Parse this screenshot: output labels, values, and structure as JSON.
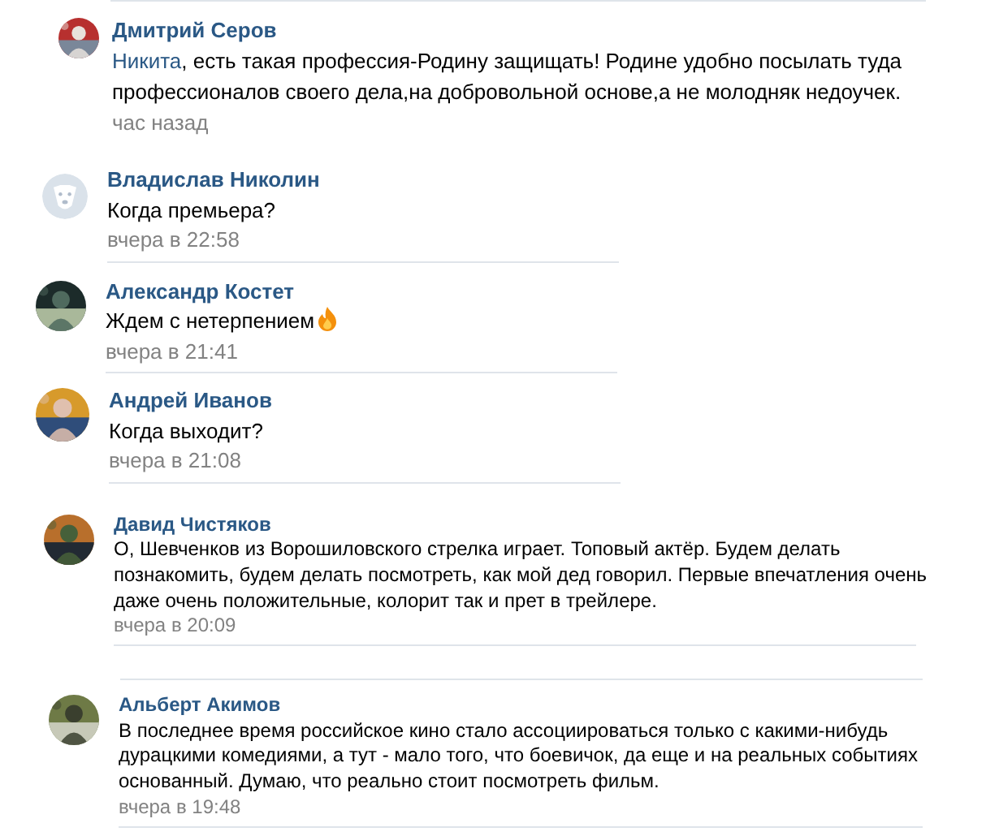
{
  "comments": [
    {
      "author": "Дмитрий Серов",
      "mention": "Никита",
      "text": ", есть такая профессия-Родину защищать! Родине удобно посылать туда профессионалов своего дела,на добровольной основе,а не молодняк недоучек.",
      "time": "час назад",
      "default_avatar": false,
      "emoji": false
    },
    {
      "author": "Владислав Николин",
      "text": "Когда премьера?",
      "time": "вчера в 22:58",
      "default_avatar": true,
      "emoji": false
    },
    {
      "author": "Александр Костет",
      "text": "Ждем с нетерпением",
      "time": "вчера в 21:41",
      "default_avatar": false,
      "emoji": true
    },
    {
      "author": "Андрей Иванов",
      "text": "Когда выходит?",
      "time": "вчера в 21:08",
      "default_avatar": false,
      "emoji": false
    },
    {
      "author": "Давид Чистяков",
      "text": "О, Шевченков из Ворошиловского стрелка играет. Топовый актёр. Будем делать познакомить, будем делать посмотреть, как мой дед говорил. Первые впечатления очень даже очень положительные, колорит так и прет в трейлере.",
      "time": "вчера в 20:09",
      "default_avatar": false,
      "emoji": false
    },
    {
      "author": "Альберт Акимов",
      "text": "В последнее время российское кино стало ассоциироваться только с какими-нибудь дурацкими комедиями, а тут - мало того, что боевичок, да еще и на реальных событиях основанный. Думаю, что реально стоит посмотреть фильм.",
      "time": "вчера в 19:48",
      "default_avatar": false,
      "emoji": false
    }
  ]
}
